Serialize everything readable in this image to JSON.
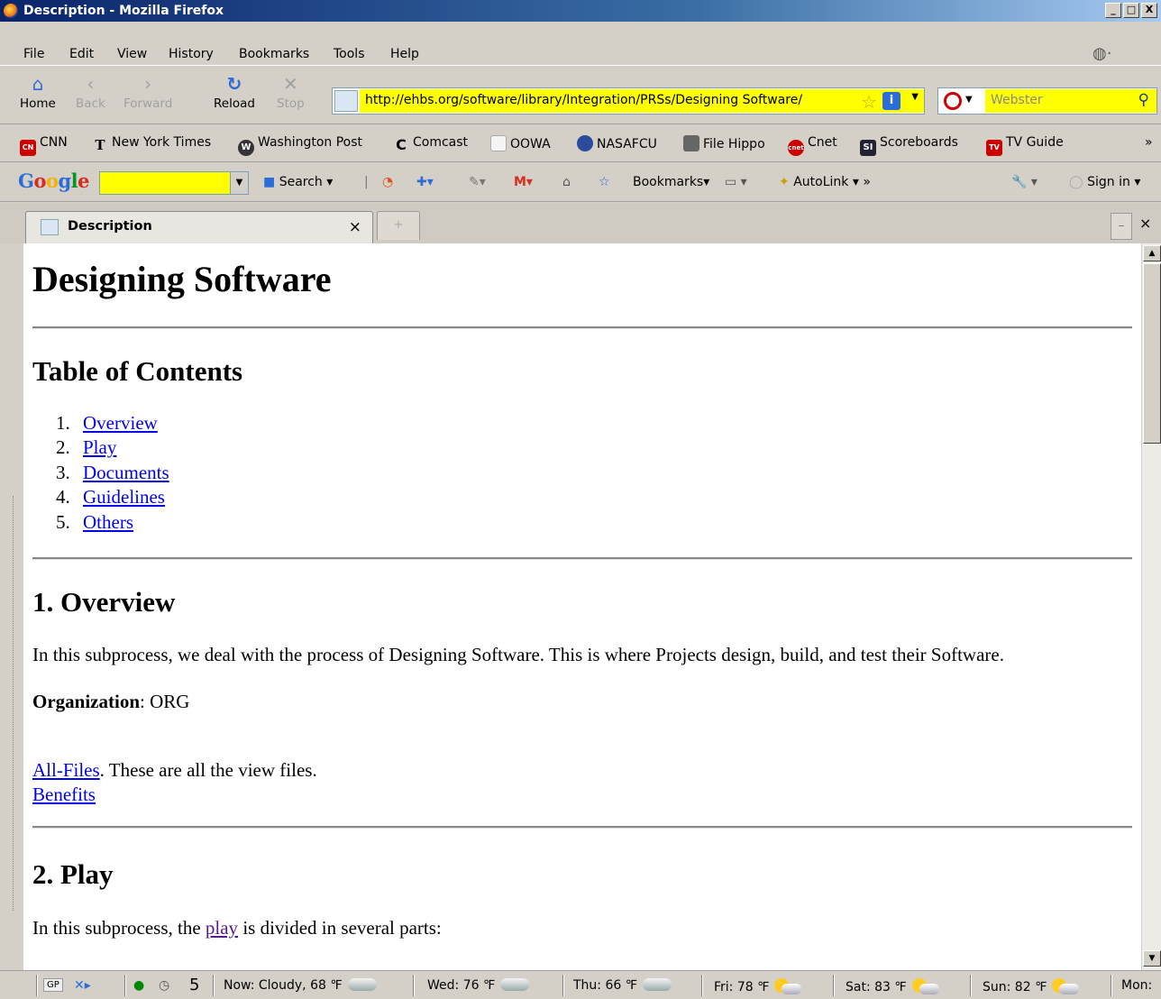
{
  "window": {
    "title": "Description - Mozilla Firefox",
    "minimize": "_",
    "maximize": "□",
    "close": "X"
  },
  "menu": [
    "File",
    "Edit",
    "View",
    "History",
    "Bookmarks",
    "Tools",
    "Help"
  ],
  "nav": {
    "home": "Home",
    "back": "Back",
    "forward": "Forward",
    "reload": "Reload",
    "stop": "Stop",
    "url": "http://ehbs.org/software/library/Integration/PRSs/Designing Software/",
    "search_placeholder": "Webster"
  },
  "bookmarks": [
    "CNN",
    "New York Times",
    "Washington Post",
    "Comcast",
    "OOWA",
    "NASAFCU",
    "File Hippo",
    "Cnet",
    "Scoreboards",
    "TV Guide"
  ],
  "bookmarks_more": "»",
  "google_toolbar": {
    "logo": "Google",
    "search": "Search",
    "bookmarks": "Bookmarks",
    "autolink": "AutoLink",
    "more": "»",
    "signin": "Sign in"
  },
  "tab": {
    "title": "Description",
    "close": "×"
  },
  "page": {
    "title": "Designing Software",
    "toc_heading": "Table of Contents",
    "toc": [
      {
        "num": "1.",
        "label": "Overview"
      },
      {
        "num": "2.",
        "label": "Play"
      },
      {
        "num": "3.",
        "label": "Documents"
      },
      {
        "num": "4.",
        "label": "Guidelines"
      },
      {
        "num": "5.",
        "label": "Others"
      }
    ],
    "overview_heading": "1. Overview",
    "overview_text": "In this subprocess, we deal with the process of Designing Software. This is where Projects design, build, and test their Software.",
    "org_label": "Organization",
    "org_value": ": ORG",
    "allfiles_link": "All-Files",
    "allfiles_text": ". These are all the view files.",
    "benefits_link": "Benefits",
    "play_heading": "2. Play",
    "play_text_pre": "In this subprocess, the ",
    "play_link": "play",
    "play_text_post": " is divided in several parts:"
  },
  "status": {
    "gp": "GP",
    "count": "5",
    "weather": [
      {
        "label": "Now: Cloudy, 68 ℉",
        "icon": "cloud"
      },
      {
        "label": "Wed: 76 ℉",
        "icon": "cloud"
      },
      {
        "label": "Thu: 66 ℉",
        "icon": "cloud"
      },
      {
        "label": "Fri: 78 ℉",
        "icon": "sun"
      },
      {
        "label": "Sat: 83 ℉",
        "icon": "sun"
      },
      {
        "label": "Sun: 82 ℉",
        "icon": "sun"
      },
      {
        "label": "Mon:",
        "icon": "none"
      }
    ]
  }
}
